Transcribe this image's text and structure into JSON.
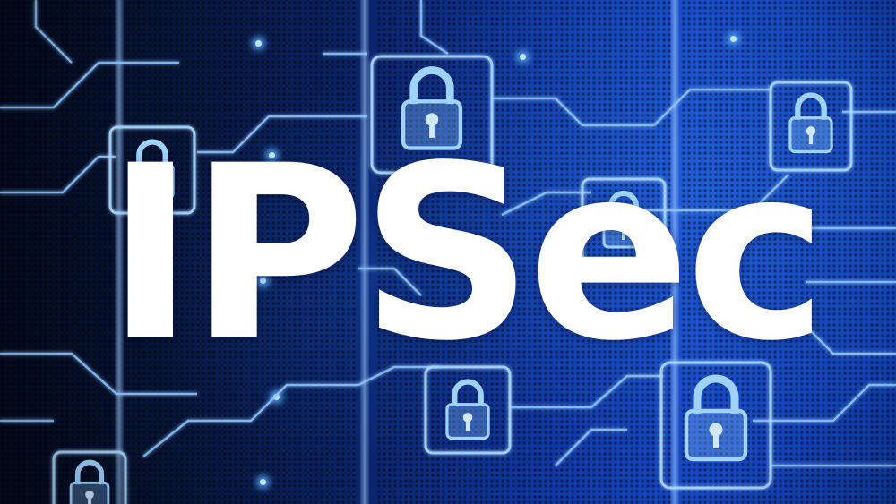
{
  "image": {
    "title_text": "IPSec",
    "icons": [
      "padlock-icon",
      "circuit-lines"
    ],
    "colors": {
      "background_dark": "#030a1e",
      "background_blue": "#1748c4",
      "circuit_glow": "#9fd2ff",
      "title": "#ffffff"
    }
  }
}
